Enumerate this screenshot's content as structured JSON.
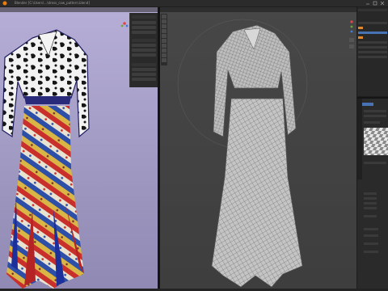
{
  "app": {
    "title": "Blender [C:\\Users\\...\\dress_cow_pattern.blend]",
    "window_icon": "blender-logo-icon"
  },
  "left_viewport": {
    "mode": "material-preview",
    "background": "#a9a2cf",
    "garments": [
      "cow-print-cropped-jacket",
      "patchwork-mermaid-skirt"
    ],
    "n_panel_visible": true
  },
  "right_viewport": {
    "mode": "wireframe",
    "background": "#444444",
    "garments": [
      "cropped-jacket-mesh",
      "mermaid-skirt-mesh"
    ]
  },
  "outliner": {
    "selected_row_color": "#4772b3",
    "accent_icon_color": "#e0872c"
  },
  "properties": {
    "active_tab_color": "#4772b3",
    "preview": "checker-material-preview"
  },
  "colors": {
    "ui_dark": "#1d1d1d",
    "panel": "#2a2a2a",
    "select_blue": "#4772b3"
  }
}
